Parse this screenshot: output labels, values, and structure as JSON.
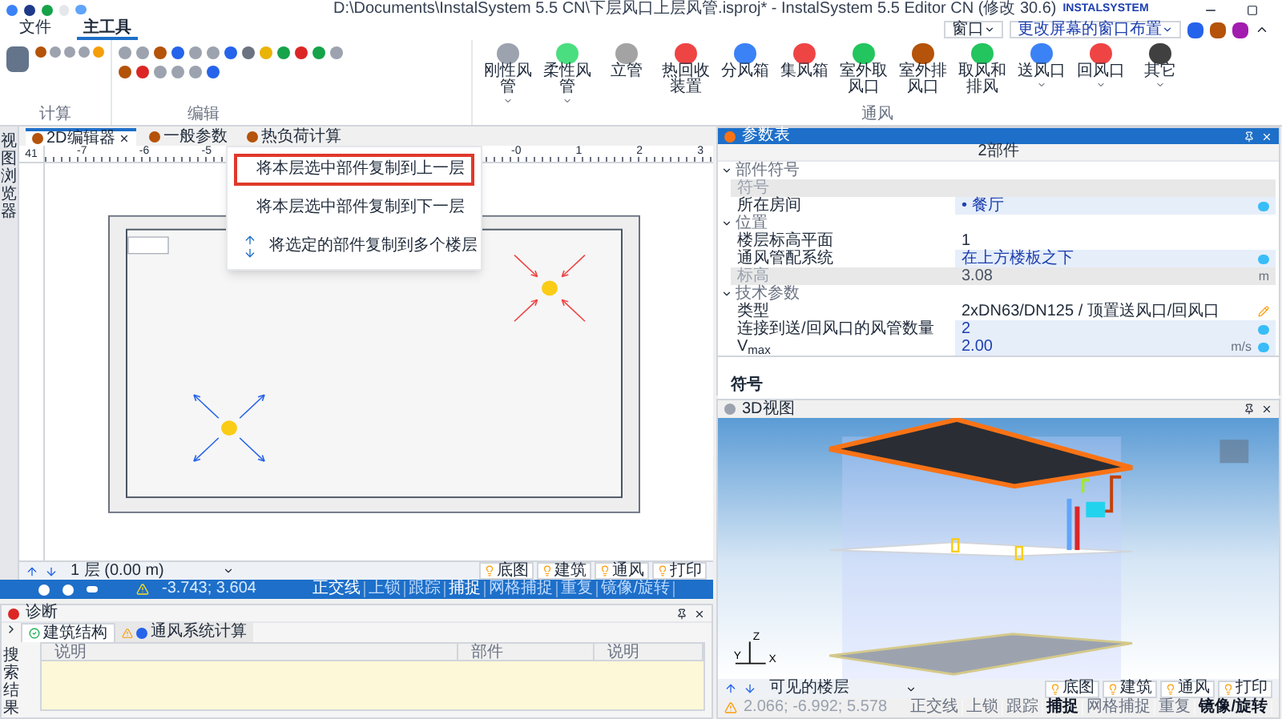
{
  "window": {
    "title": "D:\\Documents\\InstalSystem 5.5 CN\\下层风口上层风管.isproj* - InstalSystem 5.5 Editor CN (修改 30.6)",
    "logo": "INSTALSYSTEM"
  },
  "menu_tabs": [
    {
      "label": "文件",
      "selected": false
    },
    {
      "label": "主工具",
      "selected": true
    }
  ],
  "window_menu": {
    "label": "窗口"
  },
  "layout_select": {
    "value": "更改屏幕的窗口布置"
  },
  "ribbon": {
    "groups": [
      "计算",
      "编辑",
      "通风"
    ],
    "ventilation_tools": [
      {
        "label": "刚性风管",
        "dropdown": true,
        "color": "#9ca3af"
      },
      {
        "label": "柔性风管",
        "dropdown": true,
        "color": "#4ade80"
      },
      {
        "label": "立管",
        "dropdown": false,
        "color": "#a3a3a3"
      },
      {
        "label": "热回收装置",
        "dropdown": false,
        "color": "#ef4444"
      },
      {
        "label": "分风箱",
        "dropdown": false,
        "color": "#3b82f6"
      },
      {
        "label": "集风箱",
        "dropdown": false,
        "color": "#ef4444"
      },
      {
        "label": "室外取风口",
        "dropdown": false,
        "color": "#22c55e"
      },
      {
        "label": "室外排风口",
        "dropdown": false,
        "color": "#b45309"
      },
      {
        "label": "取风和排风",
        "dropdown": false,
        "color": "#22c55e"
      },
      {
        "label": "送风口",
        "dropdown": true,
        "color": "#3b82f6"
      },
      {
        "label": "回风口",
        "dropdown": true,
        "color": "#ef4444"
      },
      {
        "label": "其它",
        "dropdown": true,
        "color": "#404040"
      }
    ]
  },
  "copy_menu": [
    {
      "label": "将本层选中部件复制到上一层",
      "kind": "up",
      "selected": true
    },
    {
      "label": "将本层选中部件复制到下一层",
      "kind": "down",
      "selected": false
    },
    {
      "label": "将选定的部件复制到多个楼层",
      "kind": "multi",
      "selected": false
    }
  ],
  "side_panel": {
    "label": "视图浏览器"
  },
  "doc_tabs": [
    {
      "label": "2D编辑器",
      "selected": true,
      "closable": true
    },
    {
      "label": "一般参数",
      "selected": false,
      "closable": false
    },
    {
      "label": "热负荷计算",
      "selected": false,
      "closable": false
    }
  ],
  "ruler": {
    "corner": "41",
    "ticks": [
      "-7",
      "-6",
      "-5",
      "-0",
      "1",
      "2",
      "3"
    ]
  },
  "floor_bar": {
    "floor": "1 层 (0.00 m)",
    "layers": [
      {
        "label": "底图",
        "on": true
      },
      {
        "label": "建筑",
        "on": true
      },
      {
        "label": "通风",
        "on": true
      },
      {
        "label": "打印",
        "on": true
      }
    ]
  },
  "status_bar": {
    "coordinates": "-3.743; 3.604",
    "modes": [
      {
        "label": "正交线",
        "on": true
      },
      {
        "label": "上锁",
        "on": false
      },
      {
        "label": "跟踪",
        "on": false
      },
      {
        "label": "捕捉",
        "on": true
      },
      {
        "label": "网格捕捉",
        "on": false
      },
      {
        "label": "重复",
        "on": false
      },
      {
        "label": "镜像/旋转",
        "on": false
      }
    ]
  },
  "diagnostics": {
    "title": "诊断",
    "side_label": "搜索结果",
    "tabs": [
      {
        "label": "建筑结构",
        "kind": "ok",
        "selected": true
      },
      {
        "label": "通风系统计算",
        "kind": "warning",
        "selected": false
      }
    ],
    "columns": [
      "说明",
      "部件",
      "说明"
    ]
  },
  "properties": {
    "title": "参数表",
    "subtitle": "2部件",
    "sections": [
      {
        "title": "部件符号",
        "expanded": true,
        "rows": [
          {
            "name": "符号",
            "kind": "readonly"
          },
          {
            "name": "所在房间",
            "value": "• 餐厅",
            "kind": "linked"
          }
        ]
      },
      {
        "title": "位置",
        "expanded": true,
        "rows": [
          {
            "name": "楼层标高平面",
            "value": "1",
            "kind": "editable"
          },
          {
            "name": "通风管配系统",
            "value": "在上方楼板之下",
            "kind": "linked"
          },
          {
            "name": "标高",
            "value": "3.08",
            "unit": "m",
            "kind": "readonly"
          }
        ]
      },
      {
        "title": "技术参数",
        "expanded": true,
        "rows": [
          {
            "name": "类型",
            "value": "2xDN63/DN125 / 顶置送风口/回风口",
            "kind": "pencil"
          },
          {
            "name": "连接到送/回风口的风管数量",
            "value": "2",
            "kind": "linked"
          },
          {
            "name": "V$_{max}$",
            "value": "2.00",
            "unit": "m/s",
            "kind": "linked"
          }
        ]
      }
    ],
    "description": "符号"
  },
  "view3d": {
    "title": "3D视图",
    "axis_labels": [
      "Z",
      "Y",
      "X"
    ],
    "floors": "可见的楼层",
    "layers": [
      {
        "label": "底图",
        "on": true
      },
      {
        "label": "建筑",
        "on": true
      },
      {
        "label": "通风",
        "on": true
      },
      {
        "label": "打印",
        "on": true
      }
    ],
    "coordinates": "2.066; -6.992; 5.578",
    "modes": [
      {
        "label": "正交线",
        "on": false
      },
      {
        "label": "上锁",
        "on": false
      },
      {
        "label": "跟踪",
        "on": false
      },
      {
        "label": "捕捉",
        "on": true
      },
      {
        "label": "网格捕捉",
        "on": false
      },
      {
        "label": "重复",
        "on": false
      },
      {
        "label": "镜像/旋转",
        "on": true
      }
    ]
  }
}
